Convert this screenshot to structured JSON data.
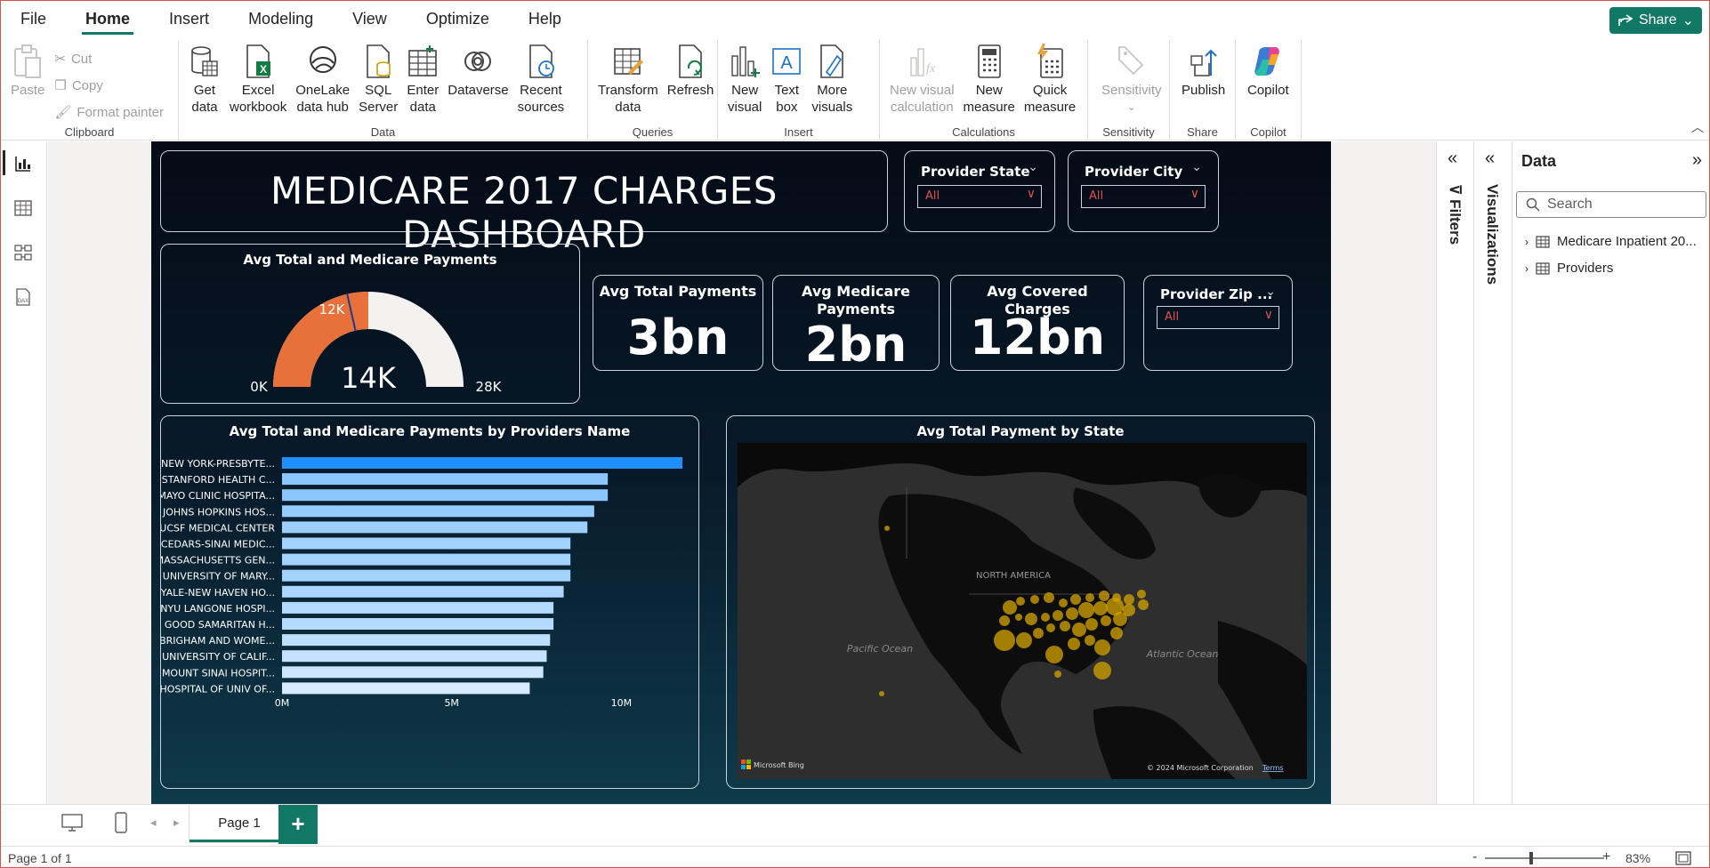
{
  "menubar": {
    "items": [
      "File",
      "Home",
      "Insert",
      "Modeling",
      "View",
      "Optimize",
      "Help"
    ],
    "active": "Home",
    "share_label": "Share"
  },
  "ribbon": {
    "clipboard": {
      "paste": "Paste",
      "cut": "Cut",
      "copy": "Copy",
      "format_painter": "Format painter",
      "label": "Clipboard"
    },
    "data": {
      "get_data": "Get\ndata",
      "excel": "Excel\nworkbook",
      "onelake": "OneLake\ndata hub",
      "sql": "SQL\nServer",
      "enter": "Enter\ndata",
      "dataverse": "Dataverse",
      "recent": "Recent\nsources",
      "label": "Data"
    },
    "queries": {
      "transform": "Transform\ndata",
      "refresh": "Refresh",
      "label": "Queries"
    },
    "insert": {
      "new_visual": "New\nvisual",
      "text_box": "Text\nbox",
      "more_visuals": "More\nvisuals",
      "label": "Insert"
    },
    "calculations": {
      "new_visual_calc": "New visual\ncalculation",
      "new_measure": "New\nmeasure",
      "quick_measure": "Quick\nmeasure",
      "label": "Calculations"
    },
    "sensitivity": {
      "btn": "Sensitivity",
      "label": "Sensitivity"
    },
    "share": {
      "publish": "Publish",
      "label": "Share"
    },
    "copilot": {
      "btn": "Copilot",
      "label": "Copilot"
    }
  },
  "report": {
    "title": "MEDICARE 2017 CHARGES DASHBOARD",
    "slicers": {
      "state": {
        "title": "Provider State",
        "value": "All"
      },
      "city": {
        "title": "Provider City",
        "value": "All"
      },
      "zip": {
        "title": "Provider Zip ...",
        "value": "All"
      }
    },
    "gauge": {
      "title": "Avg Total and Medicare Payments",
      "min_label": "0K",
      "max_label": "28K",
      "target_label": "12K",
      "value_label": "14K",
      "value": 14,
      "target": 12,
      "max": 28,
      "fill_color": "#e8703a",
      "track_color": "#f3f2f1"
    },
    "kpis": {
      "total": {
        "title": "Avg Total Payments",
        "value": "3bn"
      },
      "medicare": {
        "title": "Avg Medicare Payments",
        "value": "2bn"
      },
      "covered": {
        "title": "Avg Covered Charges",
        "value": "12bn"
      }
    },
    "map": {
      "title": "Avg Total Payment by State",
      "labels": {
        "na": "NORTH AMERICA",
        "pacific": "Pacific Ocean",
        "atlantic": "Atlantic Ocean"
      },
      "attribution": "Microsoft Bing",
      "copyright": "© 2024 Microsoft Corporation",
      "terms": "Terms",
      "bubble_color": "#d4a400"
    }
  },
  "chart_data": {
    "type": "bar",
    "title": "Avg Total and Medicare Payments by Providers Name",
    "categories": [
      "NEW YORK-PRESBYTE...",
      "STANFORD HEALTH C...",
      "MAYO CLINIC HOSPITA...",
      "JOHNS HOPKINS HOS...",
      "UCSF MEDICAL CENTER",
      "CEDARS-SINAI MEDIC...",
      "MASSACHUSETTS GEN...",
      "UNIVERSITY OF MARY...",
      "YALE-NEW HAVEN HO...",
      "NYU LANGONE HOSPI...",
      "GOOD SAMARITAN H...",
      "BRIGHAM AND WOME...",
      "UNIVERSITY OF CALIF...",
      "MOUNT SINAI HOSPIT...",
      "HOSPITAL OF UNIV OF..."
    ],
    "values": [
      11.8,
      9.6,
      9.6,
      9.2,
      9.0,
      8.5,
      8.5,
      8.5,
      8.3,
      8.0,
      8.0,
      7.9,
      7.8,
      7.7,
      7.3
    ],
    "x_ticks": [
      "0M",
      "5M",
      "10M"
    ],
    "xlim": [
      0,
      12.5
    ],
    "orientation": "horizontal",
    "colors": [
      "#1e90ff",
      "#8cc6ff",
      "#8cc6ff",
      "#96cbff",
      "#9cceff",
      "#a4d2ff",
      "#a4d2ff",
      "#a4d2ff",
      "#acd6ff",
      "#b4daff",
      "#b4daff",
      "#bcdeff",
      "#c4e2ff",
      "#cce6ff",
      "#d6ebff"
    ]
  },
  "panes": {
    "filters": "Filters",
    "visualizations": "Visualizations",
    "data": {
      "title": "Data",
      "search_placeholder": "Search",
      "tables": [
        "Medicare Inpatient 20...",
        "Providers"
      ]
    }
  },
  "pagebar": {
    "tab": "Page 1"
  },
  "statusbar": {
    "page_info": "Page 1 of 1",
    "zoom": "83%"
  }
}
